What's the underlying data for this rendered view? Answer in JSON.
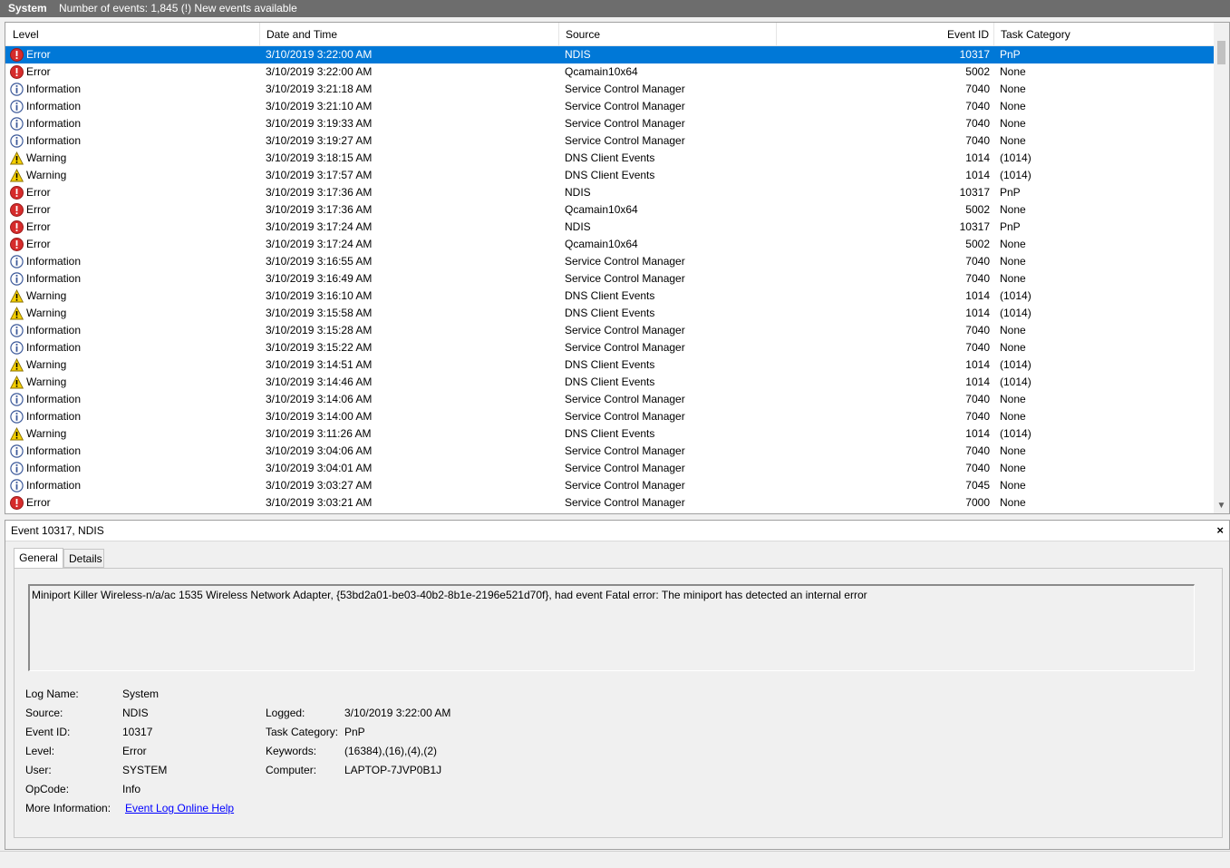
{
  "window": {
    "log_name": "System",
    "event_count_text": "Number of events: 1,845 (!) New events available"
  },
  "columns": {
    "level": "Level",
    "date_time": "Date and Time",
    "source": "Source",
    "event_id": "Event ID",
    "task_category": "Task Category"
  },
  "events": [
    {
      "level": "Error",
      "date": "3/10/2019 3:22:00 AM",
      "source": "NDIS",
      "id": "10317",
      "category": "PnP",
      "icon": "error-icon",
      "selected": true
    },
    {
      "level": "Error",
      "date": "3/10/2019 3:22:00 AM",
      "source": "Qcamain10x64",
      "id": "5002",
      "category": "None",
      "icon": "error-icon"
    },
    {
      "level": "Information",
      "date": "3/10/2019 3:21:18 AM",
      "source": "Service Control Manager",
      "id": "7040",
      "category": "None",
      "icon": "info-icon"
    },
    {
      "level": "Information",
      "date": "3/10/2019 3:21:10 AM",
      "source": "Service Control Manager",
      "id": "7040",
      "category": "None",
      "icon": "info-icon"
    },
    {
      "level": "Information",
      "date": "3/10/2019 3:19:33 AM",
      "source": "Service Control Manager",
      "id": "7040",
      "category": "None",
      "icon": "info-icon"
    },
    {
      "level": "Information",
      "date": "3/10/2019 3:19:27 AM",
      "source": "Service Control Manager",
      "id": "7040",
      "category": "None",
      "icon": "info-icon"
    },
    {
      "level": "Warning",
      "date": "3/10/2019 3:18:15 AM",
      "source": "DNS Client Events",
      "id": "1014",
      "category": "(1014)",
      "icon": "warning-icon"
    },
    {
      "level": "Warning",
      "date": "3/10/2019 3:17:57 AM",
      "source": "DNS Client Events",
      "id": "1014",
      "category": "(1014)",
      "icon": "warning-icon"
    },
    {
      "level": "Error",
      "date": "3/10/2019 3:17:36 AM",
      "source": "NDIS",
      "id": "10317",
      "category": "PnP",
      "icon": "error-icon"
    },
    {
      "level": "Error",
      "date": "3/10/2019 3:17:36 AM",
      "source": "Qcamain10x64",
      "id": "5002",
      "category": "None",
      "icon": "error-icon"
    },
    {
      "level": "Error",
      "date": "3/10/2019 3:17:24 AM",
      "source": "NDIS",
      "id": "10317",
      "category": "PnP",
      "icon": "error-icon"
    },
    {
      "level": "Error",
      "date": "3/10/2019 3:17:24 AM",
      "source": "Qcamain10x64",
      "id": "5002",
      "category": "None",
      "icon": "error-icon"
    },
    {
      "level": "Information",
      "date": "3/10/2019 3:16:55 AM",
      "source": "Service Control Manager",
      "id": "7040",
      "category": "None",
      "icon": "info-icon"
    },
    {
      "level": "Information",
      "date": "3/10/2019 3:16:49 AM",
      "source": "Service Control Manager",
      "id": "7040",
      "category": "None",
      "icon": "info-icon"
    },
    {
      "level": "Warning",
      "date": "3/10/2019 3:16:10 AM",
      "source": "DNS Client Events",
      "id": "1014",
      "category": "(1014)",
      "icon": "warning-icon"
    },
    {
      "level": "Warning",
      "date": "3/10/2019 3:15:58 AM",
      "source": "DNS Client Events",
      "id": "1014",
      "category": "(1014)",
      "icon": "warning-icon"
    },
    {
      "level": "Information",
      "date": "3/10/2019 3:15:28 AM",
      "source": "Service Control Manager",
      "id": "7040",
      "category": "None",
      "icon": "info-icon"
    },
    {
      "level": "Information",
      "date": "3/10/2019 3:15:22 AM",
      "source": "Service Control Manager",
      "id": "7040",
      "category": "None",
      "icon": "info-icon"
    },
    {
      "level": "Warning",
      "date": "3/10/2019 3:14:51 AM",
      "source": "DNS Client Events",
      "id": "1014",
      "category": "(1014)",
      "icon": "warning-icon"
    },
    {
      "level": "Warning",
      "date": "3/10/2019 3:14:46 AM",
      "source": "DNS Client Events",
      "id": "1014",
      "category": "(1014)",
      "icon": "warning-icon"
    },
    {
      "level": "Information",
      "date": "3/10/2019 3:14:06 AM",
      "source": "Service Control Manager",
      "id": "7040",
      "category": "None",
      "icon": "info-icon"
    },
    {
      "level": "Information",
      "date": "3/10/2019 3:14:00 AM",
      "source": "Service Control Manager",
      "id": "7040",
      "category": "None",
      "icon": "info-icon"
    },
    {
      "level": "Warning",
      "date": "3/10/2019 3:11:26 AM",
      "source": "DNS Client Events",
      "id": "1014",
      "category": "(1014)",
      "icon": "warning-icon"
    },
    {
      "level": "Information",
      "date": "3/10/2019 3:04:06 AM",
      "source": "Service Control Manager",
      "id": "7040",
      "category": "None",
      "icon": "info-icon"
    },
    {
      "level": "Information",
      "date": "3/10/2019 3:04:01 AM",
      "source": "Service Control Manager",
      "id": "7040",
      "category": "None",
      "icon": "info-icon"
    },
    {
      "level": "Information",
      "date": "3/10/2019 3:03:27 AM",
      "source": "Service Control Manager",
      "id": "7045",
      "category": "None",
      "icon": "info-icon"
    },
    {
      "level": "Error",
      "date": "3/10/2019 3:03:21 AM",
      "source": "Service Control Manager",
      "id": "7000",
      "category": "None",
      "icon": "error-icon"
    }
  ],
  "detail": {
    "title": "Event 10317, NDIS",
    "close_label": "×",
    "tabs": {
      "general": "General",
      "details": "Details"
    },
    "message": "Miniport Killer Wireless-n/a/ac 1535 Wireless Network Adapter, {53bd2a01-be03-40b2-8b1e-2196e521d70f}, had event Fatal error: The miniport has detected an internal error",
    "labels": {
      "log_name": "Log Name:",
      "source": "Source:",
      "event_id": "Event ID:",
      "level": "Level:",
      "user": "User:",
      "opcode": "OpCode:",
      "more_info": "More Information:",
      "logged": "Logged:",
      "task_category": "Task Category:",
      "keywords": "Keywords:",
      "computer": "Computer:"
    },
    "values": {
      "log_name": "System",
      "source": "NDIS",
      "event_id": "10317",
      "level": "Error",
      "user": "SYSTEM",
      "opcode": "Info",
      "more_info_link": "Event Log Online Help",
      "logged": "3/10/2019 3:22:00 AM",
      "task_category": "PnP",
      "keywords": "(16384),(16),(4),(2)",
      "computer": "LAPTOP-7JVP0B1J"
    }
  },
  "colors": {
    "selection": "#0078d7",
    "error": "#d62c2c",
    "warning": "#f5d000",
    "info": "#3d5a9a"
  }
}
